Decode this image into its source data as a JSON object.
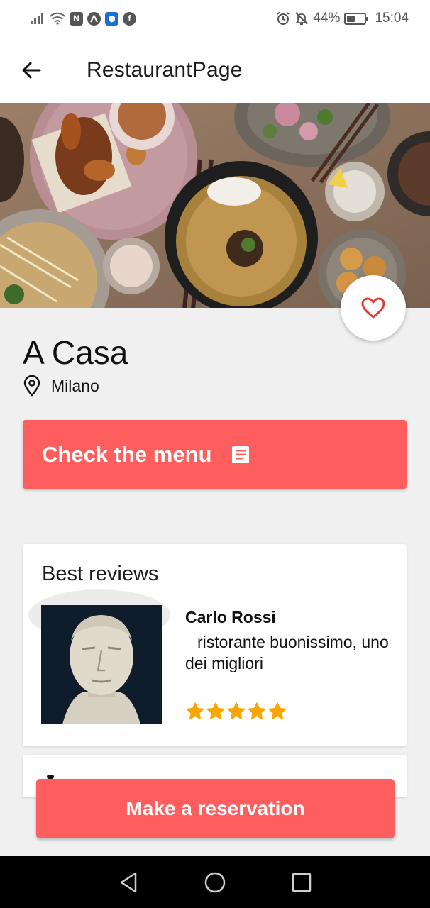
{
  "status_bar": {
    "battery": "44%",
    "battery_level": 0.44,
    "time": "15:04"
  },
  "app_bar": {
    "title": "RestaurantPage"
  },
  "restaurant": {
    "name": "A Casa",
    "city": "Milano"
  },
  "menu_button": {
    "label": "Check the menu"
  },
  "reviews": {
    "title": "Best reviews",
    "items": [
      {
        "author": "Carlo Rossi",
        "text": "ristorante buonissimo, uno dei migliori",
        "rating": 5,
        "rating_max": 5
      }
    ]
  },
  "reservation_button": {
    "label": "Make a reservation"
  },
  "colors": {
    "accent": "#fe5e5e",
    "heart": "#e53935",
    "star": "#f9a602",
    "background": "#f0f0f0"
  },
  "icons": {
    "back": "arrow-left-icon",
    "favorite": "heart-outline-icon",
    "location": "map-pin-icon",
    "menu": "article-icon",
    "star": "star-icon"
  }
}
